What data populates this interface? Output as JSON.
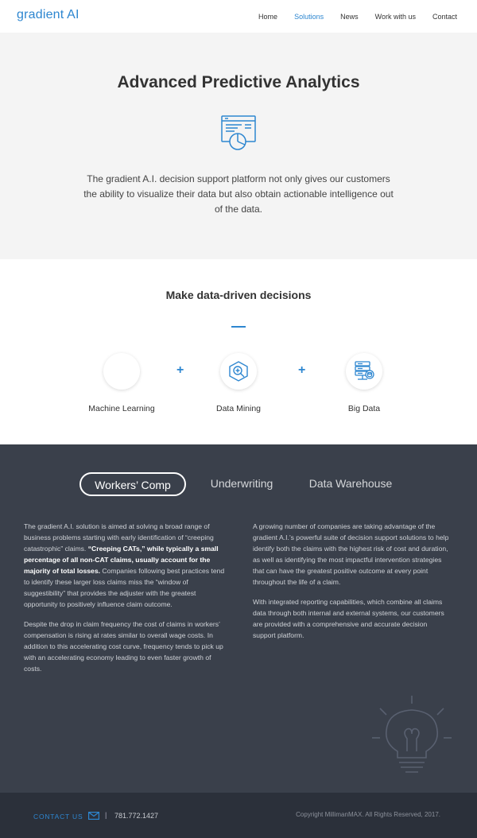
{
  "header": {
    "logo": "gradient AI",
    "nav": [
      "Home",
      "Solutions",
      "News",
      "Work with us",
      "Contact"
    ]
  },
  "hero": {
    "title": "Advanced Predictive Analytics",
    "icon": "analytics-screen-icon",
    "text": "The gradient A.I. decision support platform not only gives our customers the ability to visualize their data but also obtain actionable intelligence out of the data."
  },
  "decisions": {
    "title": "Make data-driven decisions",
    "plus": "+",
    "items": [
      {
        "label": "Machine Learning",
        "icon": "machine-learning-icon"
      },
      {
        "label": "Data Mining",
        "icon": "data-mining-icon"
      },
      {
        "label": "Big Data",
        "icon": "big-data-icon"
      }
    ]
  },
  "tabs": [
    "Workers’ Comp",
    "Underwriting",
    "Data Warehouse"
  ],
  "workers_comp": {
    "left": {
      "p1_start": "The gradient A.I. solution is aimed at solving a broad range of business problems starting with early identification of “creeping catastrophic” claims. ",
      "p1_bold": "“Creeping CATs,” while typically a small percentage of all non-CAT claims, usually account for the majority of total losses.",
      "p1_end": " Companies following best practices tend to identify these larger loss claims miss the “window of suggestibility” that provides the adjuster with the greatest opportunity to positively influence claim outcome.",
      "p2": "Despite the drop in claim frequency the cost of claims in workers’ compensation is rising at rates similar to overall wage costs. In addition to this accelerating cost curve, frequency tends to pick up with an accelerating economy leading to even faster growth of costs."
    },
    "right": {
      "p1": "A growing number of companies are taking advantage of the gradient A.I.’s powerful suite of decision support solutions to help identify both the claims with the highest risk of cost and duration, as well as identifying the most impactful intervention strategies that can have the greatest positive outcome at every point throughout the life of a claim.",
      "p2": "With integrated reporting capabilities, which combine all claims data through both internal and external systems, our customers are provided with a comprehensive and accurate decision support platform."
    }
  },
  "footer": {
    "contact_label": "CONTACT US",
    "separator": "|",
    "phone": "781.772.1427",
    "copyright": "Copyright MillimanMAX. All Rights Reserved, 2017."
  },
  "colors": {
    "accent": "#2d86d0",
    "dark_bg": "#3a404b",
    "footer_bg": "#2b303a"
  }
}
